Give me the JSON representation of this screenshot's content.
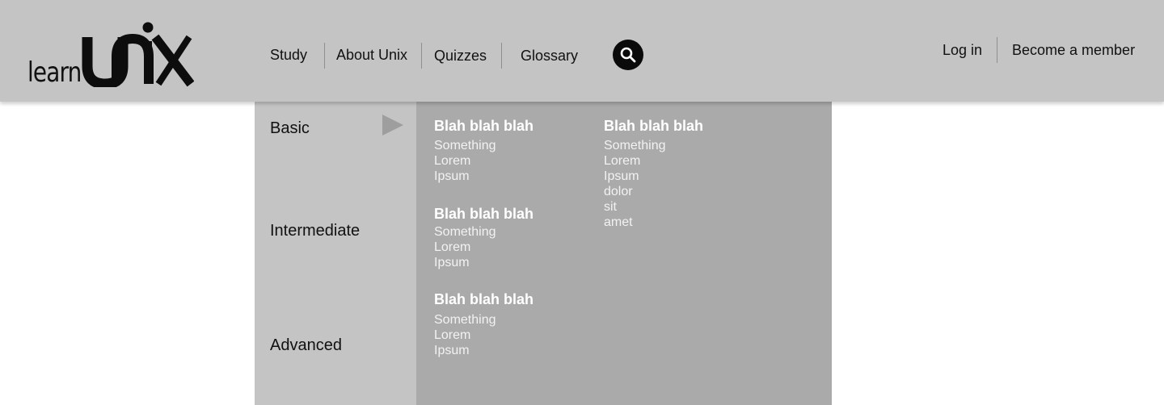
{
  "header": {
    "logo": {
      "learn": "learn",
      "brand": "unix"
    },
    "nav": [
      {
        "label": "Study"
      },
      {
        "label": "About Unix"
      },
      {
        "label": "Quizzes"
      },
      {
        "label": "Glossary"
      }
    ],
    "search_icon": "search-icon",
    "login_label": "Log in",
    "member_label": "Become a member"
  },
  "menu": {
    "levels": [
      "Basic",
      "Intermediate",
      "Advanced"
    ],
    "active_level": "Basic",
    "groups": [
      {
        "title": "Blah blah blah",
        "links": [
          "Something",
          "Lorem",
          "Ipsum"
        ]
      },
      {
        "title": "Blah blah blah",
        "links": [
          "Something",
          "Lorem",
          "Ipsum"
        ]
      },
      {
        "title": "Blah blah blah",
        "links": [
          "Something",
          "Lorem",
          "Ipsum"
        ]
      },
      {
        "title": "Blah blah blah",
        "links": [
          "Something",
          "Lorem",
          "Ipsum",
          "dolor",
          "sit",
          "amet"
        ]
      }
    ]
  },
  "colors": {
    "header_bg": "#c4c4c4",
    "menu_panel_bg": "#aaaaaa",
    "text_dark": "#111111",
    "text_light": "#ffffff"
  }
}
